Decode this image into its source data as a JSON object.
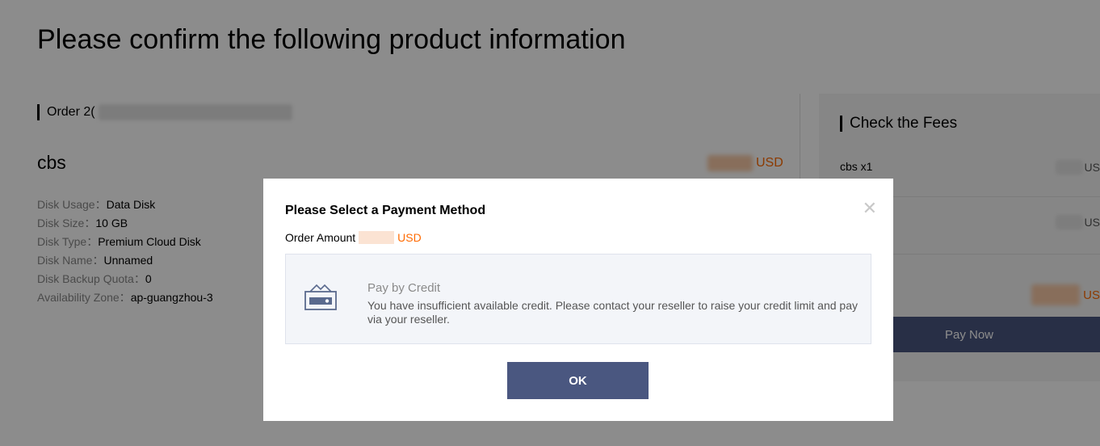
{
  "page": {
    "title": "Please confirm the following product information"
  },
  "order": {
    "label": "Order 2("
  },
  "product": {
    "name": "cbs",
    "currency": "USD",
    "specs": [
      {
        "key": "Disk Usage：",
        "value": "Data Disk"
      },
      {
        "key": "Disk Size：",
        "value": "10 GB"
      },
      {
        "key": "Disk Type：",
        "value": "Premium Cloud Disk"
      },
      {
        "key": "Disk Name：",
        "value": "Unnamed"
      },
      {
        "key": "Disk Backup Quota：",
        "value": "0"
      },
      {
        "key": "Availability Zone：",
        "value": "ap-guangzhou-3"
      }
    ]
  },
  "fees": {
    "title": "Check the Fees",
    "item_label": "cbs x1",
    "currency_truncated": "US",
    "pay_now_label": "Pay Now"
  },
  "modal": {
    "title": "Please Select a Payment Method",
    "order_amount_label": "Order Amount",
    "order_amount_currency": "USD",
    "close_symbol": "✕",
    "option": {
      "name": "Pay by Credit",
      "description": "You have insufficient available credit. Please contact your reseller to raise your credit limit and pay via your reseller.",
      "icon": "wallet-card-icon"
    },
    "ok_label": "OK"
  },
  "colors": {
    "accent": "#4a5780",
    "price": "#ff6a00",
    "overlay": "rgba(0,0,0,0.45)"
  }
}
